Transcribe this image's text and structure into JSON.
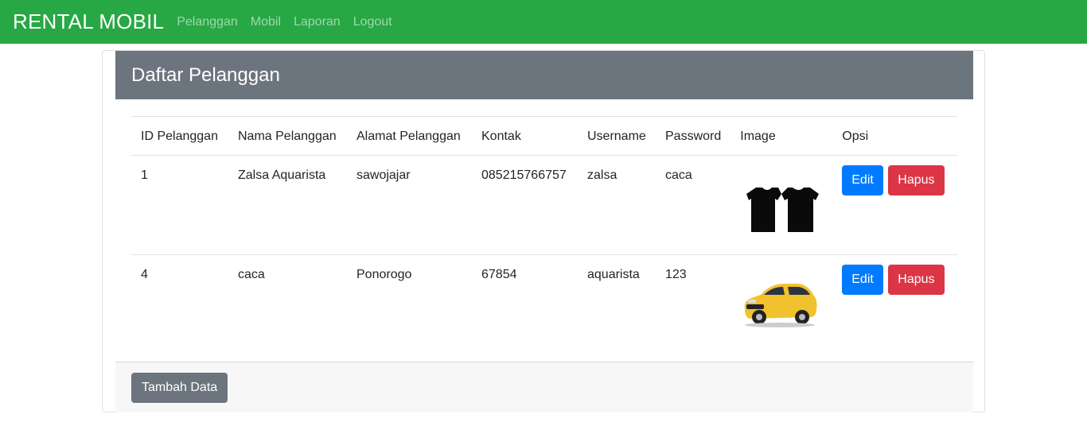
{
  "navbar": {
    "brand": "RENTAL MOBIL",
    "links": [
      "Pelanggan",
      "Mobil",
      "Laporan",
      "Logout"
    ]
  },
  "card": {
    "title": "Daftar Pelanggan",
    "columns": [
      "ID Pelanggan",
      "Nama Pelanggan",
      "Alamat Pelanggan",
      "Kontak",
      "Username",
      "Password",
      "Image",
      "Opsi"
    ],
    "rows": [
      {
        "id": "1",
        "nama": "Zalsa Aquarista",
        "alamat": "sawojajar",
        "kontak": "085215766757",
        "username": "zalsa",
        "password": "caca",
        "image_icon": "tshirt-image",
        "edit": "Edit",
        "hapus": "Hapus"
      },
      {
        "id": "4",
        "nama": "caca",
        "alamat": "Ponorogo",
        "kontak": "67854",
        "username": "aquarista",
        "password": "123",
        "image_icon": "car-image",
        "edit": "Edit",
        "hapus": "Hapus"
      }
    ],
    "add_button": "Tambah Data"
  },
  "colors": {
    "navbar": "#28a745",
    "header": "#6c757d",
    "edit": "#007bff",
    "hapus": "#dc3545"
  }
}
